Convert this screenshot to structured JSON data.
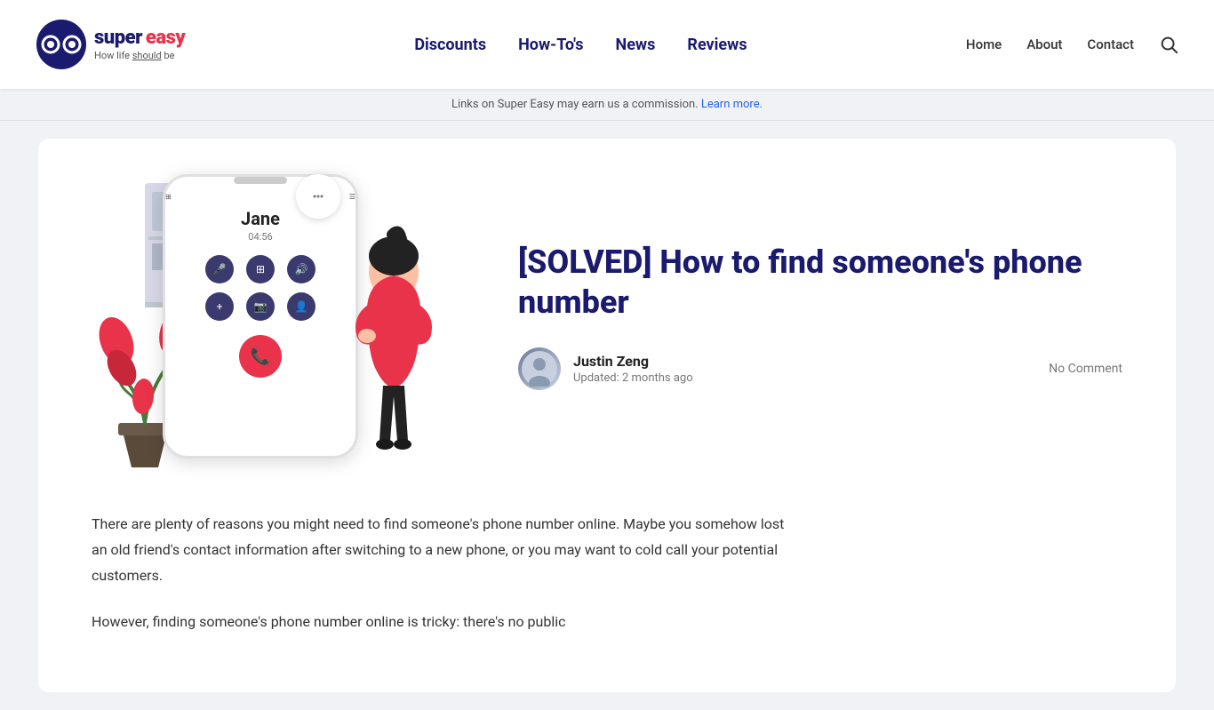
{
  "site": {
    "logo_super": "super",
    "logo_easy": "easy",
    "tagline_prefix": "How life ",
    "tagline_emphasis": "should",
    "tagline_suffix": " be"
  },
  "nav": {
    "main_links": [
      {
        "label": "Discounts",
        "href": "#"
      },
      {
        "label": "How-To's",
        "href": "#"
      },
      {
        "label": "News",
        "href": "#"
      },
      {
        "label": "Reviews",
        "href": "#"
      }
    ],
    "secondary_links": [
      {
        "label": "Home",
        "href": "#"
      },
      {
        "label": "About",
        "href": "#"
      },
      {
        "label": "Contact",
        "href": "#"
      }
    ]
  },
  "announcement": {
    "text": "Links on Super Easy may earn us a commission.",
    "link_text": "Learn more.",
    "link_href": "#"
  },
  "article": {
    "title": "[SOLVED] How to find someone's phone number",
    "author_name": "Justin Zeng",
    "updated": "Updated: 2 months ago",
    "comment_count": "No Comment",
    "phone_caller": "Jane",
    "phone_duration": "04:56",
    "body_para1": "There are plenty of reasons you might need to find someone's phone number online. Maybe you somehow lost an old friend's contact information after switching to a new phone, or you may want to cold call your potential customers.",
    "body_para2": "However, finding someone's phone number online is tricky: there's no public"
  },
  "colors": {
    "brand_dark": "#1a1a6e",
    "brand_red": "#e8334a",
    "accent_blue": "#2563eb"
  }
}
